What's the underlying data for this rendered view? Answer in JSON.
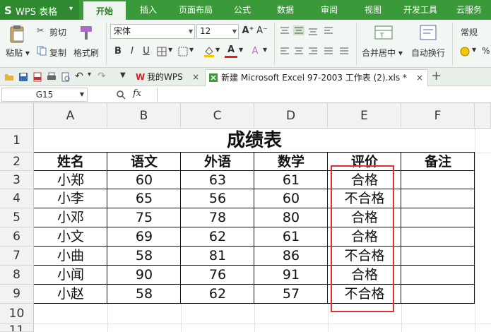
{
  "app": {
    "logo": "S",
    "name": "WPS 表格"
  },
  "menu": [
    "开始",
    "插入",
    "页面布局",
    "公式",
    "数据",
    "审阅",
    "视图",
    "开发工具",
    "云服务"
  ],
  "ribbon": {
    "paste": "粘贴",
    "cut": "剪切",
    "copy": "复制",
    "format_painter": "格式刷",
    "font_name": "宋体",
    "font_size": "12",
    "bold": "B",
    "italic": "I",
    "underline": "U",
    "merge_center": "合并居中",
    "wrap_text": "自动换行",
    "number_format": "常规",
    "percent": "%",
    "increase_font": "A⁺",
    "decrease_font": "A⁻",
    "font_color_letter": "A",
    "clear_letter": "A"
  },
  "quickbar": {
    "my_wps": "我的WPS",
    "doc_title": "新建 Microsoft Excel 97-2003 工作表 (2).xls *",
    "add_tab": "+",
    "close": "×"
  },
  "formula_bar": {
    "cell_ref": "G15",
    "fx": "fx"
  },
  "sheet": {
    "columns": [
      "A",
      "B",
      "C",
      "D",
      "E",
      "F"
    ],
    "rows": [
      "1",
      "2",
      "3",
      "4",
      "5",
      "6",
      "7",
      "8",
      "9",
      "10",
      "11"
    ],
    "title": "成绩表",
    "headers": [
      "姓名",
      "语文",
      "外语",
      "数学",
      "评价",
      "备注"
    ],
    "data": [
      [
        "小郑",
        "60",
        "63",
        "61",
        "合格",
        ""
      ],
      [
        "小李",
        "65",
        "56",
        "60",
        "不合格",
        ""
      ],
      [
        "小邓",
        "75",
        "78",
        "80",
        "合格",
        ""
      ],
      [
        "小文",
        "69",
        "62",
        "61",
        "合格",
        ""
      ],
      [
        "小曲",
        "58",
        "81",
        "86",
        "不合格",
        ""
      ],
      [
        "小闻",
        "90",
        "76",
        "91",
        "合格",
        ""
      ],
      [
        "小赵",
        "58",
        "62",
        "57",
        "不合格",
        ""
      ]
    ]
  },
  "colors": {
    "accent_green": "#3a9a3a",
    "highlight_red": "#e03030",
    "font_red": "#e02020",
    "fill_yellow": "#f3c600"
  }
}
